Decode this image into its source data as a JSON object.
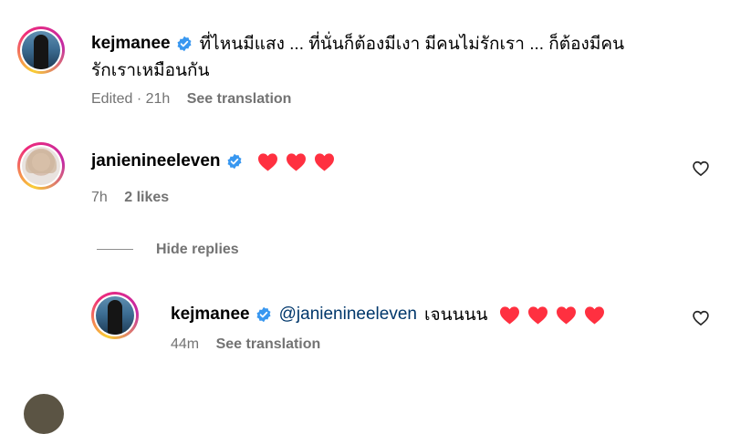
{
  "comments": [
    {
      "username": "kejmanee",
      "text_line1": "ที่ไหนมีแสง ... ที่นั่นก็ต้องมีเงา มีคนไม่รักเรา ... ก็ต้องมีคน",
      "text_line2": "รักเราเหมือนกัน",
      "meta_time": "Edited · 21h",
      "meta_action": "See translation"
    },
    {
      "username": "janienineeleven",
      "hearts": [
        "heart-1",
        "heart-2",
        "heart-3"
      ],
      "meta_time": "7h",
      "meta_likes": "2 likes"
    }
  ],
  "replies_toggle": "Hide replies",
  "reply": {
    "username": "kejmanee",
    "mention": "@janienineeleven",
    "text": "เจนนนน",
    "meta_time": "44m",
    "meta_action": "See translation"
  },
  "colors": {
    "verified": "#3897f0",
    "heart": "#ff3040",
    "mention": "#00376b",
    "meta": "#737373"
  }
}
